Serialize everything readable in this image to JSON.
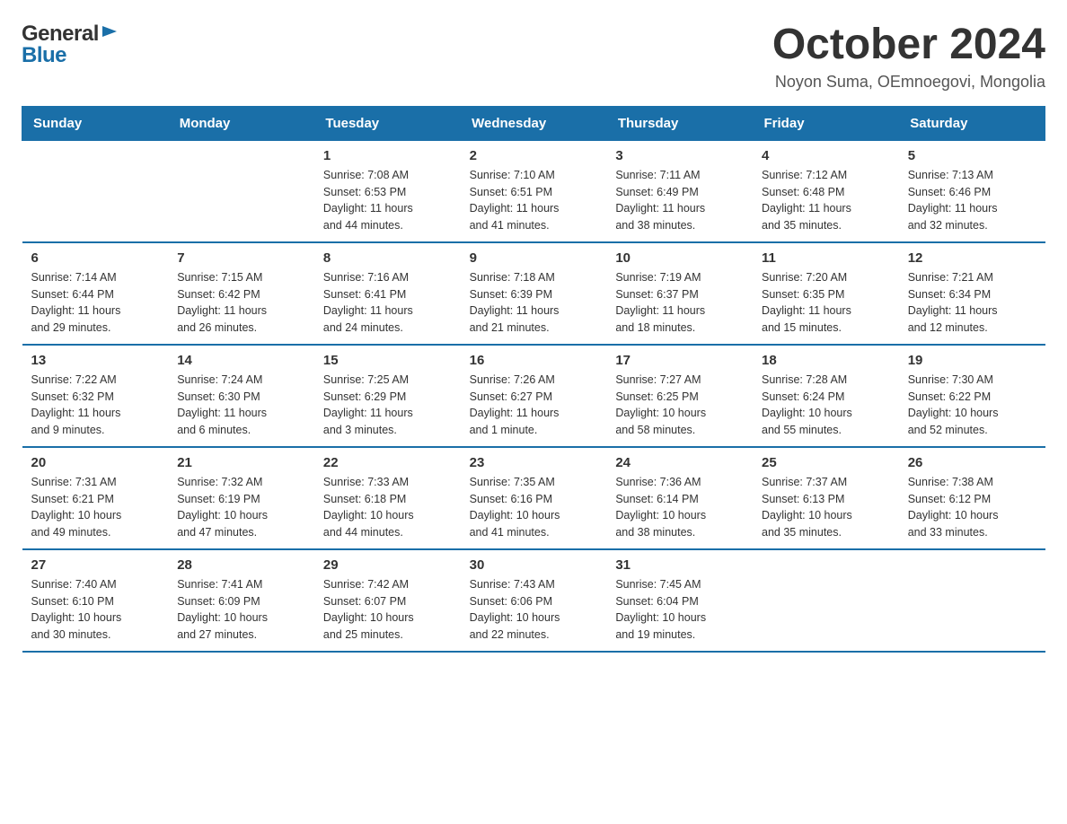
{
  "header": {
    "logo_general": "General",
    "logo_blue": "Blue",
    "month_title": "October 2024",
    "location": "Noyon Suma, OEmnoegovi, Mongolia"
  },
  "days_of_week": [
    "Sunday",
    "Monday",
    "Tuesday",
    "Wednesday",
    "Thursday",
    "Friday",
    "Saturday"
  ],
  "weeks": [
    [
      {
        "day": "",
        "info": ""
      },
      {
        "day": "",
        "info": ""
      },
      {
        "day": "1",
        "info": "Sunrise: 7:08 AM\nSunset: 6:53 PM\nDaylight: 11 hours\nand 44 minutes."
      },
      {
        "day": "2",
        "info": "Sunrise: 7:10 AM\nSunset: 6:51 PM\nDaylight: 11 hours\nand 41 minutes."
      },
      {
        "day": "3",
        "info": "Sunrise: 7:11 AM\nSunset: 6:49 PM\nDaylight: 11 hours\nand 38 minutes."
      },
      {
        "day": "4",
        "info": "Sunrise: 7:12 AM\nSunset: 6:48 PM\nDaylight: 11 hours\nand 35 minutes."
      },
      {
        "day": "5",
        "info": "Sunrise: 7:13 AM\nSunset: 6:46 PM\nDaylight: 11 hours\nand 32 minutes."
      }
    ],
    [
      {
        "day": "6",
        "info": "Sunrise: 7:14 AM\nSunset: 6:44 PM\nDaylight: 11 hours\nand 29 minutes."
      },
      {
        "day": "7",
        "info": "Sunrise: 7:15 AM\nSunset: 6:42 PM\nDaylight: 11 hours\nand 26 minutes."
      },
      {
        "day": "8",
        "info": "Sunrise: 7:16 AM\nSunset: 6:41 PM\nDaylight: 11 hours\nand 24 minutes."
      },
      {
        "day": "9",
        "info": "Sunrise: 7:18 AM\nSunset: 6:39 PM\nDaylight: 11 hours\nand 21 minutes."
      },
      {
        "day": "10",
        "info": "Sunrise: 7:19 AM\nSunset: 6:37 PM\nDaylight: 11 hours\nand 18 minutes."
      },
      {
        "day": "11",
        "info": "Sunrise: 7:20 AM\nSunset: 6:35 PM\nDaylight: 11 hours\nand 15 minutes."
      },
      {
        "day": "12",
        "info": "Sunrise: 7:21 AM\nSunset: 6:34 PM\nDaylight: 11 hours\nand 12 minutes."
      }
    ],
    [
      {
        "day": "13",
        "info": "Sunrise: 7:22 AM\nSunset: 6:32 PM\nDaylight: 11 hours\nand 9 minutes."
      },
      {
        "day": "14",
        "info": "Sunrise: 7:24 AM\nSunset: 6:30 PM\nDaylight: 11 hours\nand 6 minutes."
      },
      {
        "day": "15",
        "info": "Sunrise: 7:25 AM\nSunset: 6:29 PM\nDaylight: 11 hours\nand 3 minutes."
      },
      {
        "day": "16",
        "info": "Sunrise: 7:26 AM\nSunset: 6:27 PM\nDaylight: 11 hours\nand 1 minute."
      },
      {
        "day": "17",
        "info": "Sunrise: 7:27 AM\nSunset: 6:25 PM\nDaylight: 10 hours\nand 58 minutes."
      },
      {
        "day": "18",
        "info": "Sunrise: 7:28 AM\nSunset: 6:24 PM\nDaylight: 10 hours\nand 55 minutes."
      },
      {
        "day": "19",
        "info": "Sunrise: 7:30 AM\nSunset: 6:22 PM\nDaylight: 10 hours\nand 52 minutes."
      }
    ],
    [
      {
        "day": "20",
        "info": "Sunrise: 7:31 AM\nSunset: 6:21 PM\nDaylight: 10 hours\nand 49 minutes."
      },
      {
        "day": "21",
        "info": "Sunrise: 7:32 AM\nSunset: 6:19 PM\nDaylight: 10 hours\nand 47 minutes."
      },
      {
        "day": "22",
        "info": "Sunrise: 7:33 AM\nSunset: 6:18 PM\nDaylight: 10 hours\nand 44 minutes."
      },
      {
        "day": "23",
        "info": "Sunrise: 7:35 AM\nSunset: 6:16 PM\nDaylight: 10 hours\nand 41 minutes."
      },
      {
        "day": "24",
        "info": "Sunrise: 7:36 AM\nSunset: 6:14 PM\nDaylight: 10 hours\nand 38 minutes."
      },
      {
        "day": "25",
        "info": "Sunrise: 7:37 AM\nSunset: 6:13 PM\nDaylight: 10 hours\nand 35 minutes."
      },
      {
        "day": "26",
        "info": "Sunrise: 7:38 AM\nSunset: 6:12 PM\nDaylight: 10 hours\nand 33 minutes."
      }
    ],
    [
      {
        "day": "27",
        "info": "Sunrise: 7:40 AM\nSunset: 6:10 PM\nDaylight: 10 hours\nand 30 minutes."
      },
      {
        "day": "28",
        "info": "Sunrise: 7:41 AM\nSunset: 6:09 PM\nDaylight: 10 hours\nand 27 minutes."
      },
      {
        "day": "29",
        "info": "Sunrise: 7:42 AM\nSunset: 6:07 PM\nDaylight: 10 hours\nand 25 minutes."
      },
      {
        "day": "30",
        "info": "Sunrise: 7:43 AM\nSunset: 6:06 PM\nDaylight: 10 hours\nand 22 minutes."
      },
      {
        "day": "31",
        "info": "Sunrise: 7:45 AM\nSunset: 6:04 PM\nDaylight: 10 hours\nand 19 minutes."
      },
      {
        "day": "",
        "info": ""
      },
      {
        "day": "",
        "info": ""
      }
    ]
  ]
}
